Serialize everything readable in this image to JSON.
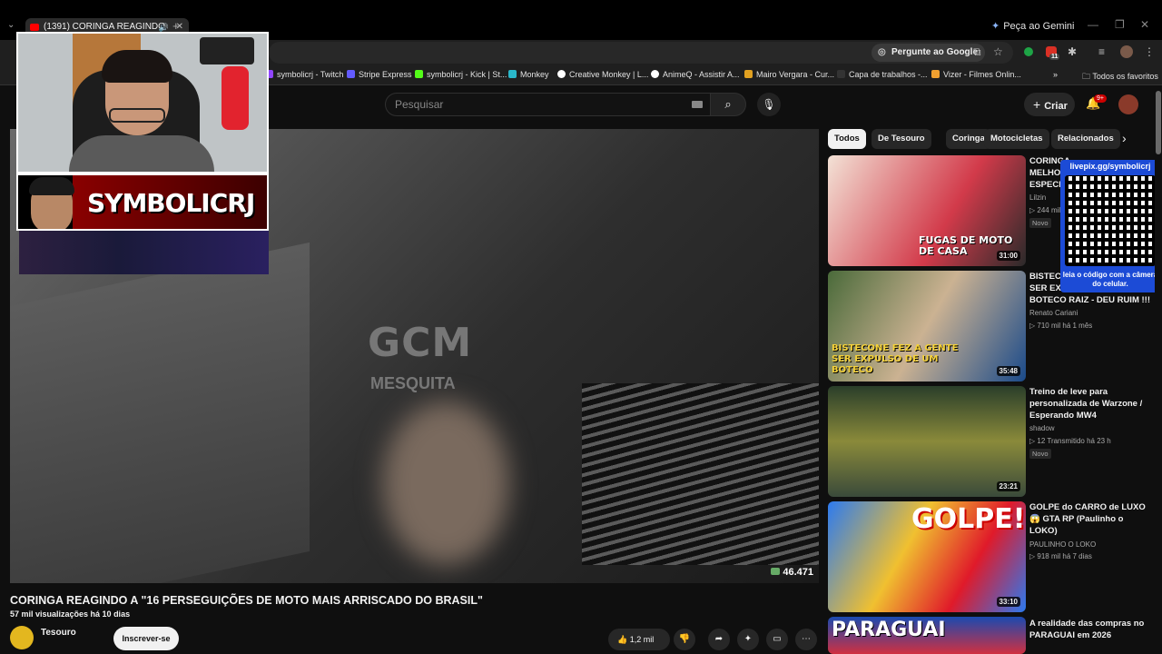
{
  "browser": {
    "tab_title": "(1391) CORINGA REAGINDO",
    "gemini_label": "Peça ao Gemini",
    "ask_google": "Pergunte ao Google",
    "bookmarks": [
      "symbolicrj - Twitch",
      "Stripe Express",
      "symbolicrj - Kick | St...",
      "Monkey",
      "Creative Monkey | L...",
      "AnimeQ - Assistir A...",
      "Mairo Vergara - Cur...",
      "Capa de trabalhos -...",
      "Vizer - Filmes Onlin..."
    ],
    "bookmark_colors": [
      "#9146ff",
      "#635bff",
      "#53fc18",
      "#2ab7ca",
      "#ffffff",
      "#ffffff",
      "#e0a020",
      "#333333",
      "#f0a030"
    ],
    "all_favorites": "Todos os favoritos",
    "ext_badge": "11"
  },
  "youtube": {
    "search_placeholder": "Pesquisar",
    "create_label": "Criar",
    "notif_count": "9+",
    "video_overlay": {
      "gcm": "GCM",
      "mesquita": "MESQUITA",
      "count": "46.471"
    },
    "streamer_name": "SYMBOLICRJ",
    "video_title": "CORINGA REAGINDO A \"16 PERSEGUIÇÕES DE MOTO MAIS ARRISCADO DO BRASIL\"",
    "video_meta": "57 mil visualizações  há 10 dias",
    "channel_name": "Tesouro",
    "subscribe_label": "Inscrever-se",
    "like_count": "1,2 mil",
    "chips": [
      "Todos",
      "De Tesouro",
      "Coringa",
      "Motocicletas",
      "Relacionados"
    ],
    "recommendations": [
      {
        "title": "CORINGA ... MELHO... ESPECI...",
        "title_lines": [
          "CORINGA",
          "MELHO",
          "ESPECI"
        ],
        "channel": "Lilzin",
        "meta": "▷ 244 mil",
        "badge": "Novo",
        "duration": "31:00",
        "thumb_text": "FUGAS DE MOTO DE CASA"
      },
      {
        "title_lines": [
          "BISTECONE",
          "SER EX...",
          "BOTECO RAIZ - DEU RUIM !!!"
        ],
        "channel": "Renato Cariani",
        "meta": "▷ 710 mil  há 1 mês",
        "badge": "",
        "duration": "35:48",
        "thumb_text": "BISTECONE FEZ A GENTE SER EXPULSO DE UM BOTECO"
      },
      {
        "title_lines": [
          "Treino de leve para",
          "personalizada de Warzone /",
          "Esperando MW4"
        ],
        "channel": "shadow",
        "meta": "▷ 12  Transmitido há 23 h",
        "badge": "Novo",
        "duration": "23:21",
        "thumb_text": ""
      },
      {
        "title_lines": [
          "GOLPE do CARRO de LUXO",
          "😱 GTA RP (Paulinho o",
          "LOKO)"
        ],
        "channel": "PAULINHO O LOKO",
        "meta": "▷ 918 mil  há 7 dias",
        "badge": "",
        "duration": "33:10",
        "thumb_text": "GOLPE!"
      },
      {
        "title_lines": [
          "A realidade das compras no",
          "PARAGUAI em 2026"
        ],
        "channel": "",
        "meta": "",
        "badge": "",
        "duration": "",
        "thumb_text": "PARAGUAI"
      }
    ],
    "qr": {
      "url": "livepix.gg/symbolicrj",
      "caption": "leia o código com a câmera do celular."
    }
  }
}
